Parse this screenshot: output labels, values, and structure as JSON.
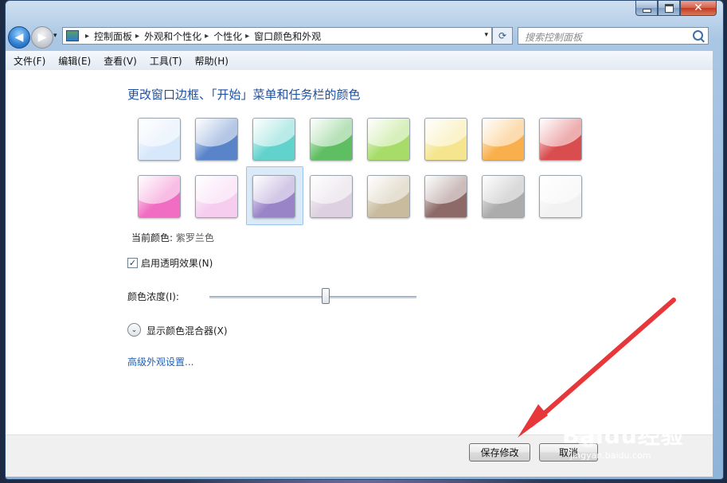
{
  "window": {
    "nav": {
      "back_glyph": "◀",
      "forward_glyph": "▶",
      "history_glyph": "▾"
    },
    "address": {
      "crumbs": [
        "控制面板",
        "外观和个性化",
        "个性化",
        "窗口颜色和外观"
      ],
      "separator": "▸",
      "dropdown_glyph": "▾",
      "refresh_glyph": "⟳"
    },
    "search": {
      "placeholder": "搜索控制面板"
    },
    "menu": [
      "文件(F)",
      "编辑(E)",
      "查看(V)",
      "工具(T)",
      "帮助(H)"
    ]
  },
  "content": {
    "title": "更改窗口边框、「开始」菜单和任务栏的颜色",
    "swatches": [
      {
        "name": "sky",
        "color": "#d8e8fb"
      },
      {
        "name": "twilight",
        "color": "#5a84c9"
      },
      {
        "name": "sea",
        "color": "#62d2cc"
      },
      {
        "name": "leaf",
        "color": "#5fbd62"
      },
      {
        "name": "lime",
        "color": "#a7dc68"
      },
      {
        "name": "sun",
        "color": "#f5e58f"
      },
      {
        "name": "pumpkin",
        "color": "#f9b04c"
      },
      {
        "name": "ruby",
        "color": "#d94d4f"
      },
      {
        "name": "fuchsia",
        "color": "#f06dc3"
      },
      {
        "name": "blush",
        "color": "#f6cdef"
      },
      {
        "name": "violet",
        "color": "#9a84c8"
      },
      {
        "name": "lavender",
        "color": "#ddd0e0"
      },
      {
        "name": "taupe",
        "color": "#c8bb9e"
      },
      {
        "name": "chocolate",
        "color": "#8d6a68"
      },
      {
        "name": "slate",
        "color": "#acacac"
      },
      {
        "name": "frost",
        "color": "#f2f2f2"
      }
    ],
    "selected_index": 10,
    "current_color_label": "当前颜色:",
    "current_color_value": "紫罗兰色",
    "transparency": {
      "label": "启用透明效果(N)",
      "checked": true,
      "check_glyph": "✓"
    },
    "intensity": {
      "label": "颜色浓度(I):",
      "value": 0.56
    },
    "mixer": {
      "label": "显示颜色混合器(X)",
      "glyph": "⌄"
    },
    "advanced_link": "高级外观设置..."
  },
  "footer": {
    "save": "保存修改",
    "cancel": "取消"
  },
  "watermark": {
    "brand": "Baidu经验",
    "url": "jingyan.baidu.com"
  },
  "annotation_color": "#e8373a"
}
